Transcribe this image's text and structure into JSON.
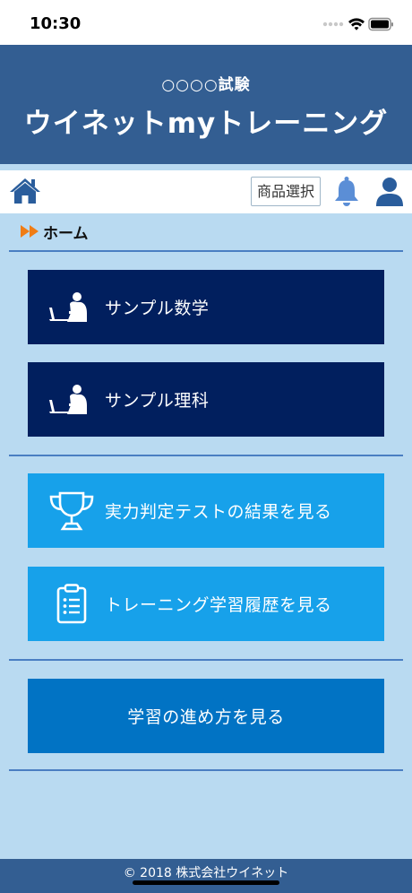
{
  "status_bar": {
    "time": "10:30"
  },
  "header": {
    "exam_name": "○○○○試験",
    "app_title": "ウイネットmyトレーニング"
  },
  "toolbar": {
    "product_select_label": "商品選択"
  },
  "breadcrumb": {
    "label": "ホーム"
  },
  "menu": {
    "subject_math": "サンプル数学",
    "subject_science": "サンプル理科",
    "test_results": "実力判定テストの結果を見る",
    "training_history": "トレーニング学習履歴を見る",
    "how_to_study": "学習の進め方を見る"
  },
  "footer": {
    "copyright": "© 2018 株式会社ウイネット"
  },
  "colors": {
    "header_bg": "#335e92",
    "dark_button": "#011f5e",
    "light_button": "#17a1ea",
    "mid_button": "#0173c4",
    "page_bg": "#b9daf1",
    "icon_blue": "#2a5d9c",
    "accent_orange": "#f07c14"
  }
}
